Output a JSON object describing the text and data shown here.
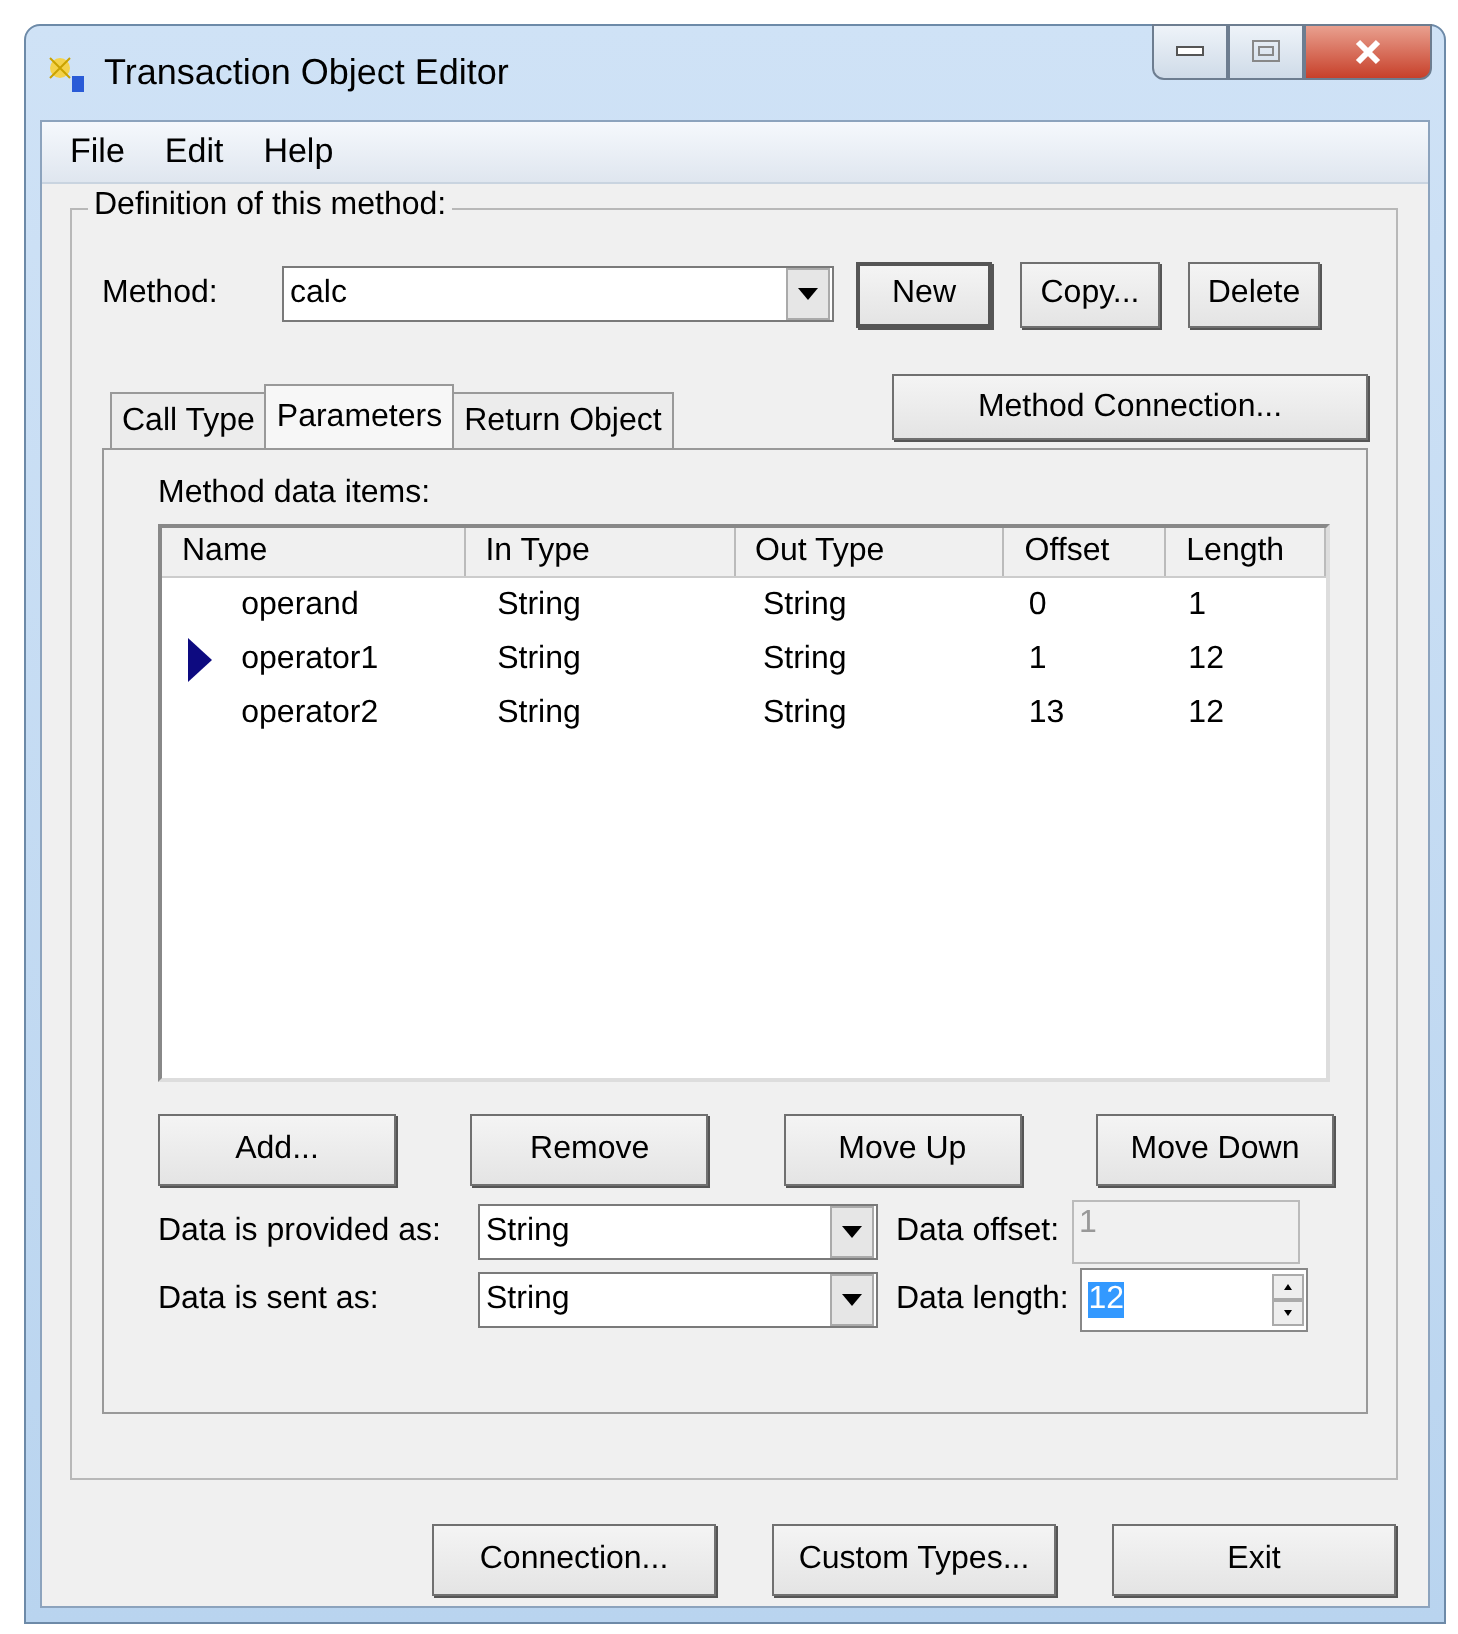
{
  "window": {
    "title": "Transaction Object Editor"
  },
  "menu": [
    "File",
    "Edit",
    "Help"
  ],
  "group": {
    "label": "Definition of this method:"
  },
  "method": {
    "label": "Method:",
    "value": "calc"
  },
  "method_buttons": [
    {
      "label": "New",
      "default": true
    },
    {
      "label": "Copy...",
      "default": false
    },
    {
      "label": "Delete",
      "default": false
    }
  ],
  "tabs": [
    {
      "label": "Call Type",
      "selected": false
    },
    {
      "label": "Parameters",
      "selected": true
    },
    {
      "label": "Return Object",
      "selected": false
    }
  ],
  "method_connection_button": "Method Connection...",
  "list": {
    "label": "Method data items:",
    "columns": [
      "Name",
      "In Type",
      "Out Type",
      "Offset",
      "Length"
    ],
    "rows": [
      {
        "cells": [
          "operand",
          "String",
          "String",
          "0",
          "1"
        ],
        "selected": false
      },
      {
        "cells": [
          "operator1",
          "String",
          "String",
          "1",
          "12"
        ],
        "selected": true
      },
      {
        "cells": [
          "operator2",
          "String",
          "String",
          "13",
          "12"
        ],
        "selected": false
      }
    ]
  },
  "list_buttons": [
    "Add...",
    "Remove",
    "Move Up",
    "Move Down"
  ],
  "provided": {
    "label": "Data is provided as:",
    "value": "String"
  },
  "sent": {
    "label": "Data is sent as:",
    "value": "String"
  },
  "offset": {
    "label": "Data offset:",
    "value": "1",
    "disabled": true
  },
  "length": {
    "label": "Data length:",
    "value": "12",
    "highlighted": true
  },
  "bottom_buttons": [
    "Connection...",
    "Custom Types...",
    "Exit"
  ]
}
